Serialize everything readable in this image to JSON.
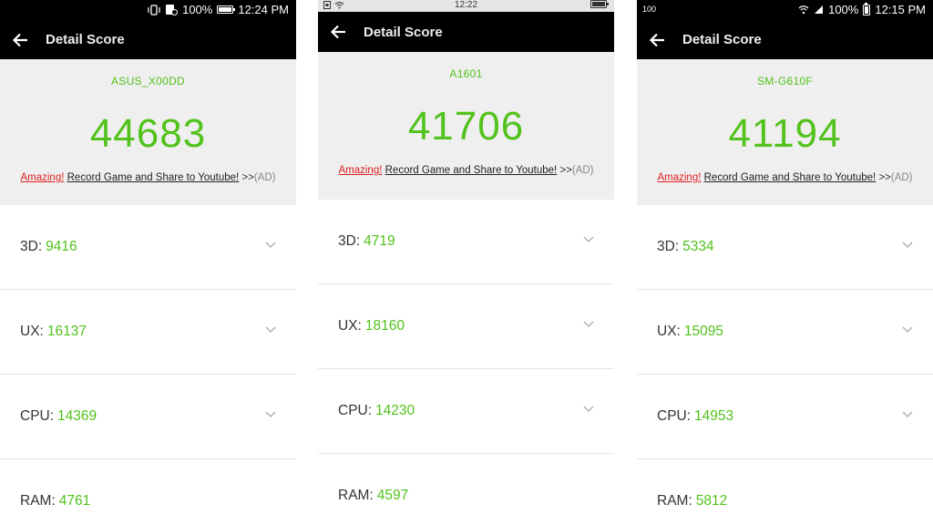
{
  "colors": {
    "score_green": "#52c21c",
    "app_bar": "#000000",
    "score_panel": "#efefef",
    "amazing_red": "#e02020"
  },
  "icons": {
    "back": "back-arrow-icon",
    "expand": "chevron-down-icon"
  },
  "phones": [
    {
      "status": {
        "battery": "100%",
        "time": "12:24 PM"
      },
      "title": "Detail Score",
      "device": "ASUS_X00DD",
      "total": "44683",
      "promo": {
        "amazing": "Amazing!",
        "link": "Record Game and Share to Youtube!",
        "arrows": ">>",
        "ad": "(AD)"
      },
      "rows": [
        {
          "label": "3D:",
          "value": "9416"
        },
        {
          "label": "UX:",
          "value": "16137"
        },
        {
          "label": "CPU:",
          "value": "14369"
        },
        {
          "label": "RAM:",
          "value": "4761"
        }
      ]
    },
    {
      "status": {
        "time": "12:22"
      },
      "title": "Detail Score",
      "device": "A1601",
      "total": "41706",
      "promo": {
        "amazing": "Amazing!",
        "link": "Record Game and Share to Youtube!",
        "arrows": ">>",
        "ad": "(AD)"
      },
      "rows": [
        {
          "label": "3D:",
          "value": "4719"
        },
        {
          "label": "UX:",
          "value": "18160"
        },
        {
          "label": "CPU:",
          "value": "14230"
        },
        {
          "label": "RAM:",
          "value": "4597"
        }
      ]
    },
    {
      "status": {
        "left": "100",
        "battery": "100%",
        "time": "12:15 PM"
      },
      "title": "Detail Score",
      "device": "SM-G610F",
      "total": "41194",
      "promo": {
        "amazing": "Amazing!",
        "link": "Record Game and Share to Youtube!",
        "arrows": ">>",
        "ad": "(AD)"
      },
      "rows": [
        {
          "label": "3D:",
          "value": "5334"
        },
        {
          "label": "UX:",
          "value": "15095"
        },
        {
          "label": "CPU:",
          "value": "14953"
        },
        {
          "label": "RAM:",
          "value": "5812"
        }
      ]
    }
  ]
}
